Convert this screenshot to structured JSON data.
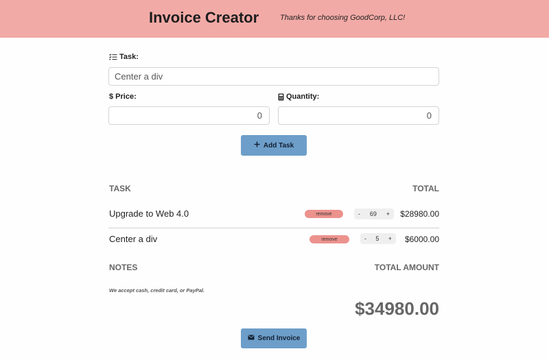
{
  "header": {
    "title": "Invoice Creator",
    "tagline": "Thanks for choosing GoodCorp, LLC!"
  },
  "form": {
    "task_label": "Task:",
    "task_value": "Center a div",
    "price_label": "$ Price:",
    "price_value": "0",
    "quantity_label": "Quantity:",
    "quantity_value": "0",
    "add_button_label": "Add Task"
  },
  "table": {
    "task_header": "TASK",
    "total_header": "TOTAL",
    "rows": [
      {
        "task": "Upgrade to Web 4.0",
        "remove_label": "remove",
        "decrement": "-",
        "quantity": "69",
        "increment": "+",
        "total": "$28980.00"
      },
      {
        "task": "Center a div",
        "remove_label": "remove",
        "decrement": "-",
        "quantity": "5",
        "increment": "+",
        "total": "$6000.00"
      }
    ]
  },
  "footer": {
    "notes_header": "NOTES",
    "total_amount_header": "TOTAL AMOUNT",
    "notes_text": "We accept cash, credit card, or PayPal.",
    "grand_total": "$34980.00",
    "send_button_label": "Send Invoice"
  },
  "colors": {
    "header_bg": "#f2aaa6",
    "button_bg": "#6d9ec9",
    "remove_bg": "#ec928d"
  },
  "icons": {
    "task": "list-check-icon",
    "quantity": "calculator-icon",
    "add": "plus-icon",
    "send": "envelope-icon"
  }
}
